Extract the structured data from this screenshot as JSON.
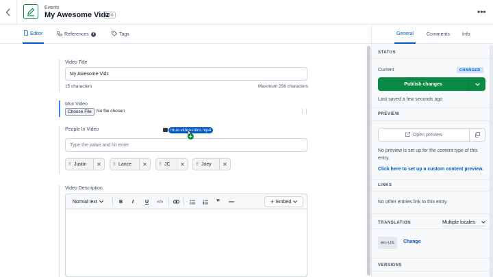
{
  "header": {
    "breadcrumb": "Events",
    "title": "My Awesome Vidz",
    "reference_count": "0"
  },
  "tabs": [
    {
      "label": "Editor"
    },
    {
      "label": "References"
    },
    {
      "label": "Tags"
    }
  ],
  "fields": {
    "video_title": {
      "label": "Video Title",
      "value": "My Awesome Vidz",
      "char_count": "15 characters",
      "max_chars": "Maximum 256 characters"
    },
    "mux_video": {
      "label": "Mux Video",
      "choose_file": "Choose File",
      "no_file": "No file chosen",
      "dragging_file": "mux-video-intro.mp4"
    },
    "people": {
      "label": "People In Video",
      "placeholder": "Type the value and hit enter",
      "items": [
        "Justin",
        "Lance",
        "JC",
        "Joey"
      ]
    },
    "description": {
      "label": "Video Description",
      "format": "Normal text",
      "toolbar": {
        "bold": "B",
        "italic": "I",
        "underline": "U",
        "code": "</>",
        "embed": "Embed"
      }
    }
  },
  "sidebar": {
    "tabs": [
      "General",
      "Comments",
      "Info"
    ],
    "status": {
      "heading": "STATUS",
      "current_label": "Current",
      "badge": "CHANGED",
      "publish": "Publish changes",
      "saved": "Last saved a few seconds ago"
    },
    "preview": {
      "heading": "PREVIEW",
      "open": "Open preview",
      "note": "No preview is set up for the content type of this entry.",
      "link": "Click here to set up a custom content preview."
    },
    "links": {
      "heading": "LINKS",
      "note": "No other entries link to this entry."
    },
    "translation": {
      "heading": "TRANSLATION",
      "mode": "Multiple locales",
      "locale": "en-US",
      "change": "Change"
    },
    "versions": {
      "heading": "VERSIONS"
    }
  },
  "colors": {
    "primary": "#0059c8",
    "publish": "#0b8a43",
    "badge_bg": "#cfe3fb"
  }
}
